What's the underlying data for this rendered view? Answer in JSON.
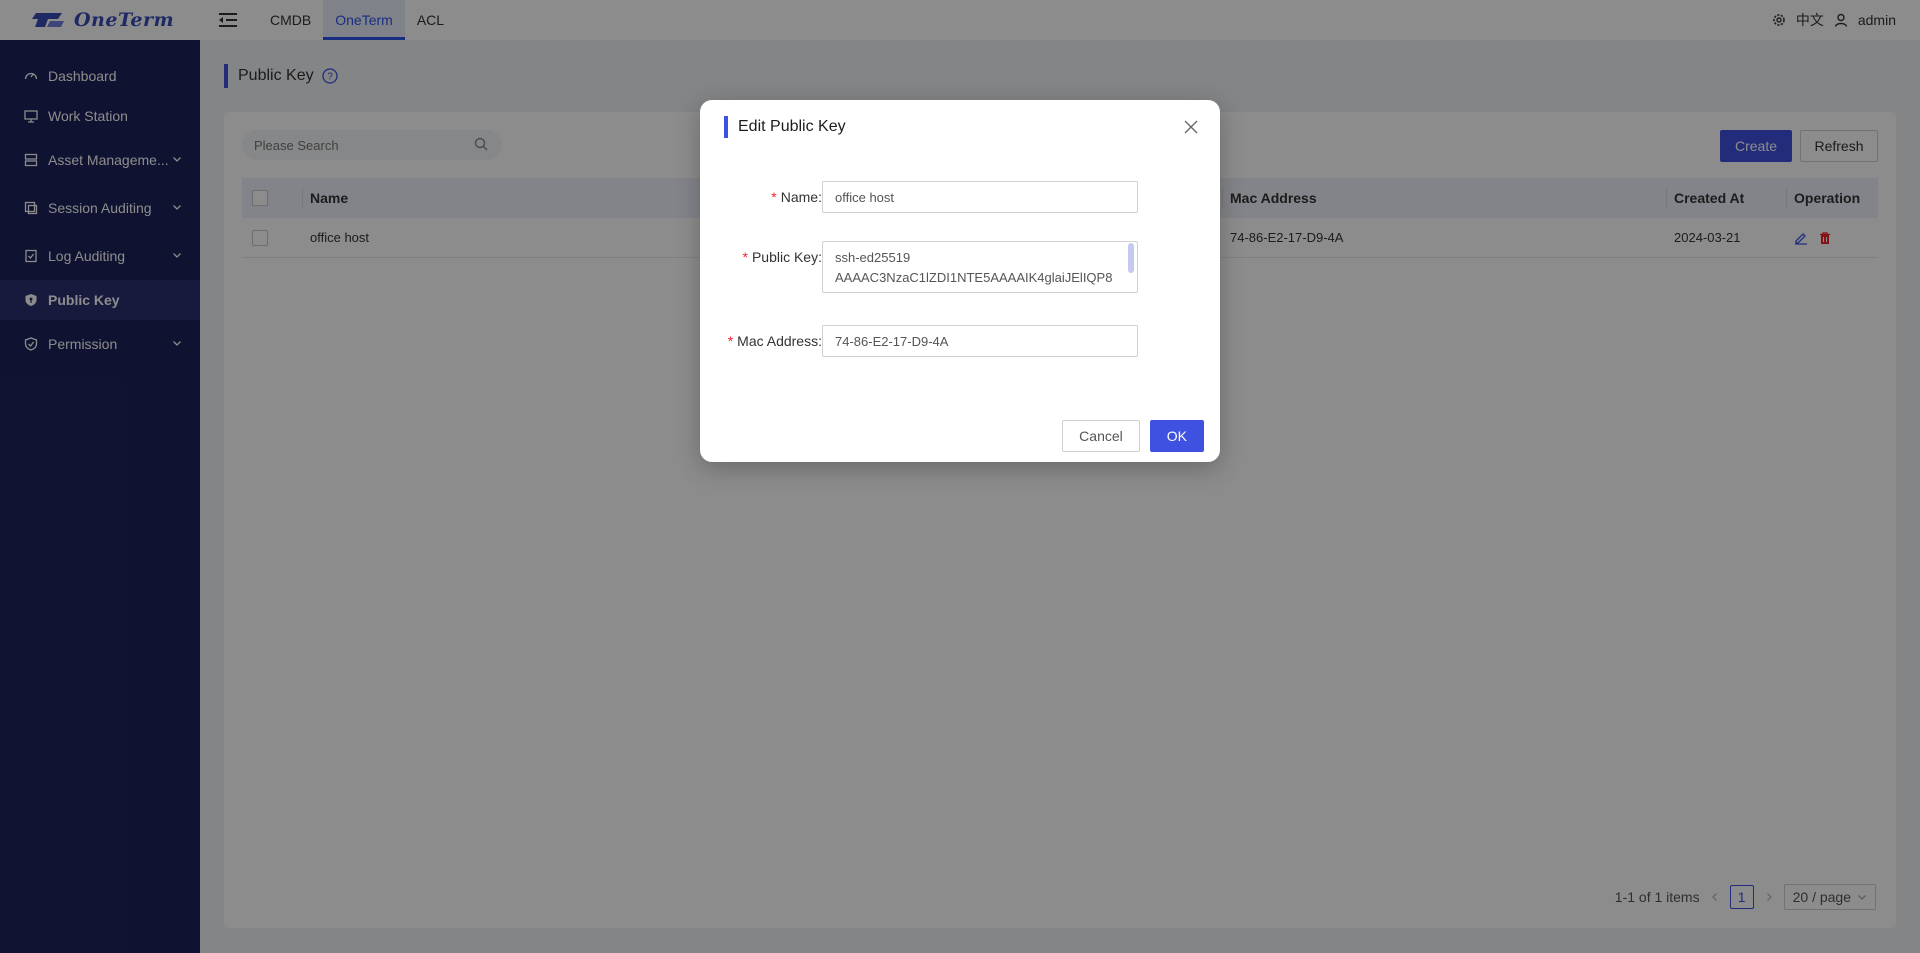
{
  "app": {
    "logo_text": "OneTerm"
  },
  "topnav": {
    "items": [
      {
        "label": "CMDB"
      },
      {
        "label": "OneTerm"
      },
      {
        "label": "ACL"
      }
    ],
    "language": "中文",
    "user": "admin"
  },
  "sidebar": {
    "items": [
      {
        "label": "Dashboard"
      },
      {
        "label": "Work Station"
      },
      {
        "label": "Asset Manageme..."
      },
      {
        "label": "Session Auditing"
      },
      {
        "label": "Log Auditing"
      },
      {
        "label": "Public Key"
      },
      {
        "label": "Permission"
      }
    ]
  },
  "page": {
    "title": "Public Key"
  },
  "toolbar": {
    "search_placeholder": "Please Search",
    "create_label": "Create",
    "refresh_label": "Refresh"
  },
  "table": {
    "columns": [
      "Name",
      "Mac Address",
      "Created At",
      "Operation"
    ],
    "rows": [
      {
        "name": "office host",
        "mac": "74-86-E2-17-D9-4A",
        "created_at": "2024-03-21"
      }
    ]
  },
  "pagination": {
    "summary": "1-1 of 1 items",
    "current": "1",
    "page_size": "20 / page"
  },
  "modal": {
    "title": "Edit Public Key",
    "fields": {
      "name_label": "Name",
      "name_value": "office host",
      "public_key_label": "Public Key",
      "public_key_value": "ssh-ed25519\nAAAAC3NzaC1lZDI1NTE5AAAAIK4glaiJElIQP8",
      "mac_label": "Mac Address",
      "mac_value": "74-86-E2-17-D9-4A"
    },
    "cancel_label": "Cancel",
    "ok_label": "OK"
  },
  "colors": {
    "primary": "#3f51e0",
    "sidebar_bg": "#1d2259",
    "danger": "#f5222d"
  }
}
